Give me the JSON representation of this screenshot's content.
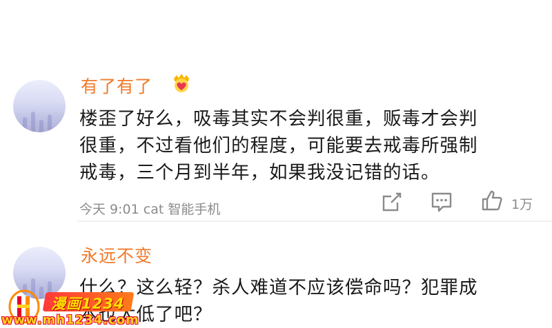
{
  "colors": {
    "username": "#f07a2a",
    "text": "#1a1a1a",
    "meta": "#8b8b8b",
    "icon": "#8a8a8a"
  },
  "comments": [
    {
      "username": "有了有了",
      "badge": "crown-heart-icon",
      "text_lines": [
        "楼歪了好么，吸毒其实不会判很重，贩毒才会判",
        "很重，不过看他们的程度，可能要去戒毒所强制",
        "戒毒，三个月到半年，如果我没记错的话。"
      ],
      "meta": "今天 9:01 cat 智能手机",
      "like_count": "1万"
    },
    {
      "username": "永远不变",
      "text_lines": [
        "什么？这么轻？杀人难道不应该偿命吗？犯罪成",
        "本也太低了吧？"
      ]
    }
  ],
  "watermark": {
    "banner": "漫画1234",
    "url": "www.mh1234.com"
  }
}
